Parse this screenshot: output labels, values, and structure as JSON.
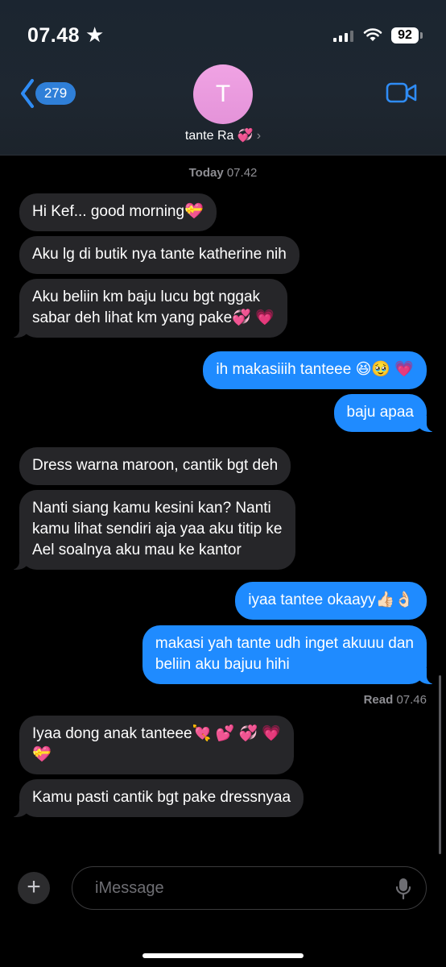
{
  "status_bar": {
    "time": "07.48",
    "star": "★",
    "battery": "92"
  },
  "header": {
    "back_count": "279",
    "avatar_initial": "T",
    "contact_name": "tante Ra 💞",
    "contact_chevron": "›"
  },
  "conversation": {
    "timestamp_day": "Today",
    "timestamp_time": " 07.42",
    "messages": [
      {
        "sender": "them",
        "text": "Hi Kef... good morning💝"
      },
      {
        "sender": "them",
        "text": "Aku lg di butik nya tante katherine nih"
      },
      {
        "sender": "them",
        "text": "Aku beliin km baju lucu bgt nggak\nsabar deh lihat km yang pake💞 💗"
      },
      {
        "sender": "me",
        "text": "ih makasiiih tanteee 😆🥹 💗"
      },
      {
        "sender": "me",
        "text": "baju apaa"
      },
      {
        "sender": "them",
        "text": "Dress warna maroon, cantik bgt deh"
      },
      {
        "sender": "them",
        "text": "Nanti siang kamu kesini kan? Nanti\nkamu lihat sendiri aja yaa aku titip ke\nAel soalnya aku mau ke kantor"
      },
      {
        "sender": "me",
        "text": "iyaa tantee okaayy👍🏻👌🏻"
      },
      {
        "sender": "me",
        "text": "makasi yah tante udh inget akuuu dan\nbeliin aku bajuu hihi"
      },
      {
        "sender": "them",
        "text": "Iyaa dong anak tanteee💘 💕 💞 💗\n💝"
      },
      {
        "sender": "them",
        "text": "Kamu pasti cantik bgt pake dressnyaa"
      }
    ],
    "read_label": "Read",
    "read_time": " 07.46"
  },
  "composer": {
    "placeholder": "iMessage",
    "plus": "+"
  },
  "colors": {
    "outgoing_bubble": "#1f8bff",
    "incoming_bubble": "#262629",
    "accent": "#2f7fd8"
  }
}
